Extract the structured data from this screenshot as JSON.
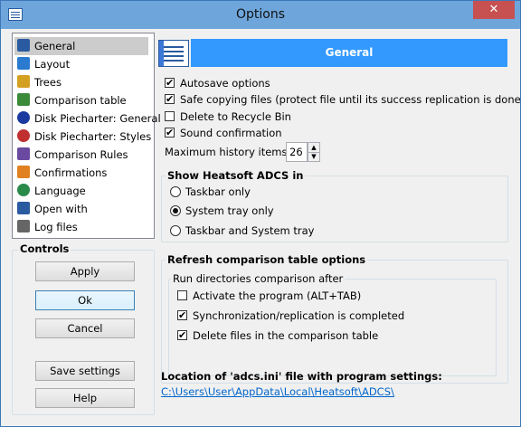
{
  "window": {
    "title": "Options",
    "close_glyph": "✕"
  },
  "nav": {
    "items": [
      {
        "label": "General",
        "icon": "list-icon",
        "color": "#2a5aa0"
      },
      {
        "label": "Layout",
        "icon": "layout-arrows-icon",
        "color": "#2a7ad0"
      },
      {
        "label": "Trees",
        "icon": "tree-folder-icon",
        "color": "#d4a020"
      },
      {
        "label": "Comparison table",
        "icon": "table-icon",
        "color": "#3a8a3a"
      },
      {
        "label": "Disk Piecharter: General",
        "icon": "piechart-icon",
        "color": "#1a3aa0"
      },
      {
        "label": "Disk Piecharter: Styles",
        "icon": "piechart-styles-icon",
        "color": "#c03030"
      },
      {
        "label": "Comparison Rules",
        "icon": "rules-icon",
        "color": "#6a4aa0"
      },
      {
        "label": "Confirmations",
        "icon": "confirm-icon",
        "color": "#e08020"
      },
      {
        "label": "Language",
        "icon": "globe-icon",
        "color": "#2a8a4a"
      },
      {
        "label": "Open with",
        "icon": "open-with-icon",
        "color": "#2a5aa0"
      },
      {
        "label": "Log files",
        "icon": "log-file-icon",
        "color": "#666666"
      }
    ]
  },
  "controls": {
    "title": "Controls",
    "apply": "Apply",
    "ok": "Ok",
    "cancel": "Cancel",
    "save_settings": "Save settings",
    "help": "Help"
  },
  "header": {
    "title": "General",
    "icon": "list-icon"
  },
  "options": {
    "autosave": {
      "label": "Autosave options",
      "checked": true
    },
    "safe_copying": {
      "label": "Safe copying files (protect file until its success replication is done)",
      "checked": true
    },
    "recycle_bin": {
      "label": "Delete to Recycle Bin",
      "checked": false
    },
    "sound": {
      "label": "Sound confirmation",
      "checked": true
    },
    "max_history_label": "Maximum history items",
    "max_history_value": "26"
  },
  "show_in": {
    "title": "Show Heatsoft ADCS in",
    "taskbar_only": "Taskbar only",
    "tray_only": "System tray only",
    "both": "Taskbar and System tray",
    "selected": "tray_only"
  },
  "refresh": {
    "title": "Refresh comparison table options",
    "run_after": "Run directories comparison after",
    "activate": {
      "label": "Activate the program (ALT+TAB)",
      "checked": false
    },
    "sync": {
      "label": "Synchronization/replication is completed",
      "checked": true
    },
    "delete": {
      "label": "Delete files in the comparison table",
      "checked": true
    }
  },
  "location": {
    "label": "Location of 'adcs.ini' file with program settings:",
    "path": "C:\\Users\\User\\AppData\\Local\\Heatsoft\\ADCS\\"
  },
  "checkmark": "✔"
}
